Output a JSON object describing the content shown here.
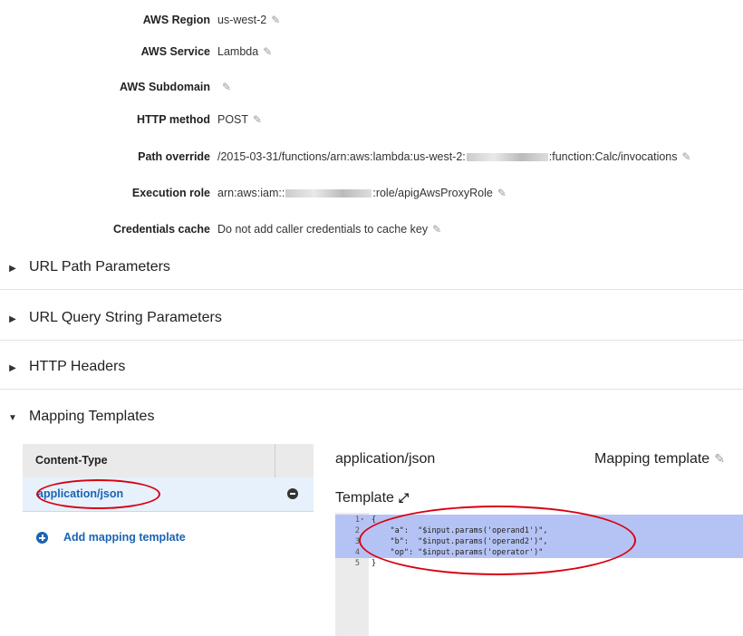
{
  "properties": [
    {
      "label": "AWS Region",
      "value": "us-west-2"
    },
    {
      "label": "AWS Service",
      "value": "Lambda"
    },
    {
      "label": "AWS Subdomain",
      "value": ""
    },
    {
      "label": "HTTP method",
      "value": "POST"
    },
    {
      "label": "Path override",
      "value_prefix": "/2015-03-31/functions/arn:aws:lambda:us-west-2:",
      "value_suffix": ":function:Calc/invocations"
    },
    {
      "label": "Execution role",
      "value_prefix": "arn:aws:iam::",
      "value_suffix": ":role/apigAwsProxyRole"
    },
    {
      "label": "Credentials cache",
      "value": "Do not add caller credentials to cache key"
    }
  ],
  "sections": [
    {
      "title": "URL Path Parameters",
      "expanded": false
    },
    {
      "title": "URL Query String Parameters",
      "expanded": false
    },
    {
      "title": "HTTP Headers",
      "expanded": false
    },
    {
      "title": "Mapping Templates",
      "expanded": true
    }
  ],
  "mapping": {
    "content_type_header": "Content-Type",
    "content_type": "application/json",
    "add_label": "Add mapping template",
    "selected_title": "application/json",
    "mapping_template_label": "Mapping template",
    "template_label": "Template"
  },
  "editor": {
    "lines": [
      {
        "num": "1",
        "code": "{",
        "highlighted": true,
        "foldable": true
      },
      {
        "num": "2",
        "code": "    \"a\":  \"$input.params('operand1')\",",
        "highlighted": true
      },
      {
        "num": "3",
        "code": "    \"b\":  \"$input.params('operand2')\",",
        "highlighted": true
      },
      {
        "num": "4",
        "code": "    \"op\": \"$input.params('operator')\"",
        "highlighted": true
      },
      {
        "num": "5",
        "code": "}",
        "highlighted": false
      }
    ]
  },
  "colors": {
    "link": "#1a63b5",
    "highlight": "#b5c3f4",
    "annotation": "#d90012"
  },
  "icons": {
    "edit": "pencil-icon",
    "collapsed": "triangle-right-icon",
    "expanded": "triangle-down-icon",
    "remove": "minus-circle-icon",
    "add": "plus-circle-icon",
    "expand": "expand-arrows-icon"
  }
}
